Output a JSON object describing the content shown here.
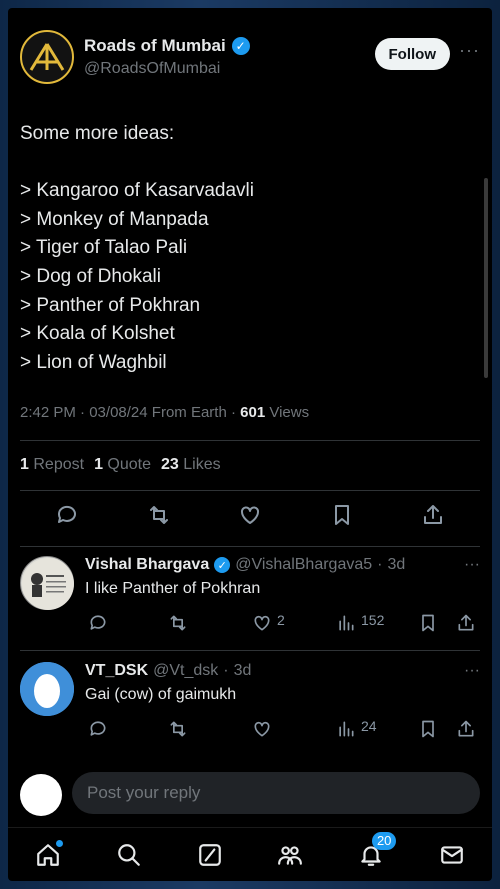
{
  "account": {
    "name": "Roads of Mumbai",
    "handle": "@RoadsOfMumbai",
    "follow_label": "Follow"
  },
  "tweet": {
    "text": "Some more ideas:\n\n> Kangaroo of Kasarvadavli\n> Monkey of Manpada\n> Tiger of Talao Pali\n> Dog of Dhokali\n> Panther of Pokhran\n> Koala of Kolshet\n> Lion of Waghbil",
    "time": "2:42 PM",
    "date": "03/08/24",
    "location": "From Earth",
    "views_count": "601",
    "views_label": "Views"
  },
  "stats": {
    "reposts_count": "1",
    "reposts_label": "Repost",
    "quotes_count": "1",
    "quotes_label": "Quote",
    "likes_count": "23",
    "likes_label": "Likes"
  },
  "replies": [
    {
      "name": "Vishal Bhargava",
      "handle": "@VishalBhargava5",
      "time": "3d",
      "text": "I like Panther of Pokhran",
      "likes": "2",
      "views": "152"
    },
    {
      "name": "VT_DSK",
      "handle": "@Vt_dsk",
      "time": "3d",
      "text": "Gai (cow) of gaimukh",
      "likes": "",
      "views": "24"
    }
  ],
  "compose": {
    "placeholder": "Post your reply"
  },
  "nav": {
    "notifications_badge": "20"
  },
  "colors": {
    "accent": "#1d9bf0",
    "background": "#000000",
    "muted": "#71767b"
  }
}
